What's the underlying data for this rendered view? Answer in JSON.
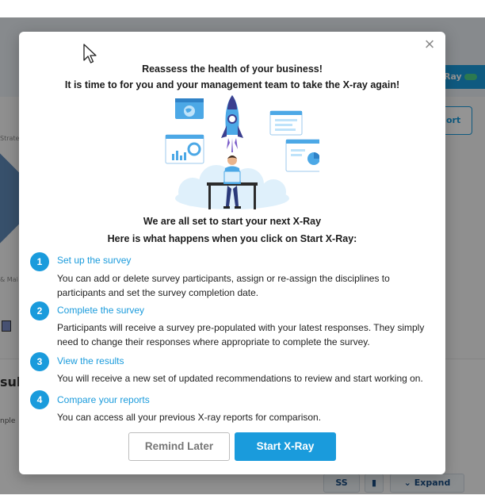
{
  "background": {
    "xray_button_label": "Ray",
    "report_button_label": "ort",
    "side_text_top": "Strate",
    "side_text_mid": "& Mai",
    "results_heading": "sult",
    "sample_label": "nple",
    "toolbar": {
      "ss_label": "SS",
      "expand_label": "Expand"
    }
  },
  "modal": {
    "headline_line1": "Reassess the health of your business!",
    "headline_line2": "It is time to for you and your management team to take the X-ray again!",
    "intro_line1": "We are all set to start your next X-Ray",
    "intro_line2": "Here is what happens when you click on Start X-Ray:",
    "steps": [
      {
        "number": "1",
        "title": "Set up the survey",
        "description": "You can add or delete survey participants, assign or re-assign the disciplines to participants and set the survey completion date."
      },
      {
        "number": "2",
        "title": "Complete the survey",
        "description": "Participants will receive a survey pre-populated with your latest responses. They simply need to change their responses where appropriate to complete the survey."
      },
      {
        "number": "3",
        "title": "View the results",
        "description": "You will receive a new set of updated recommendations to review and start working on."
      },
      {
        "number": "4",
        "title": "Compare your reports",
        "description": "You can access all your previous X-ray reports for comparison."
      }
    ],
    "remind_later_label": "Remind Later",
    "start_xray_label": "Start X-Ray",
    "close_glyph": "×"
  },
  "colors": {
    "accent": "#1a9bdc",
    "overlay": "rgba(0,0,0,0.42)"
  }
}
